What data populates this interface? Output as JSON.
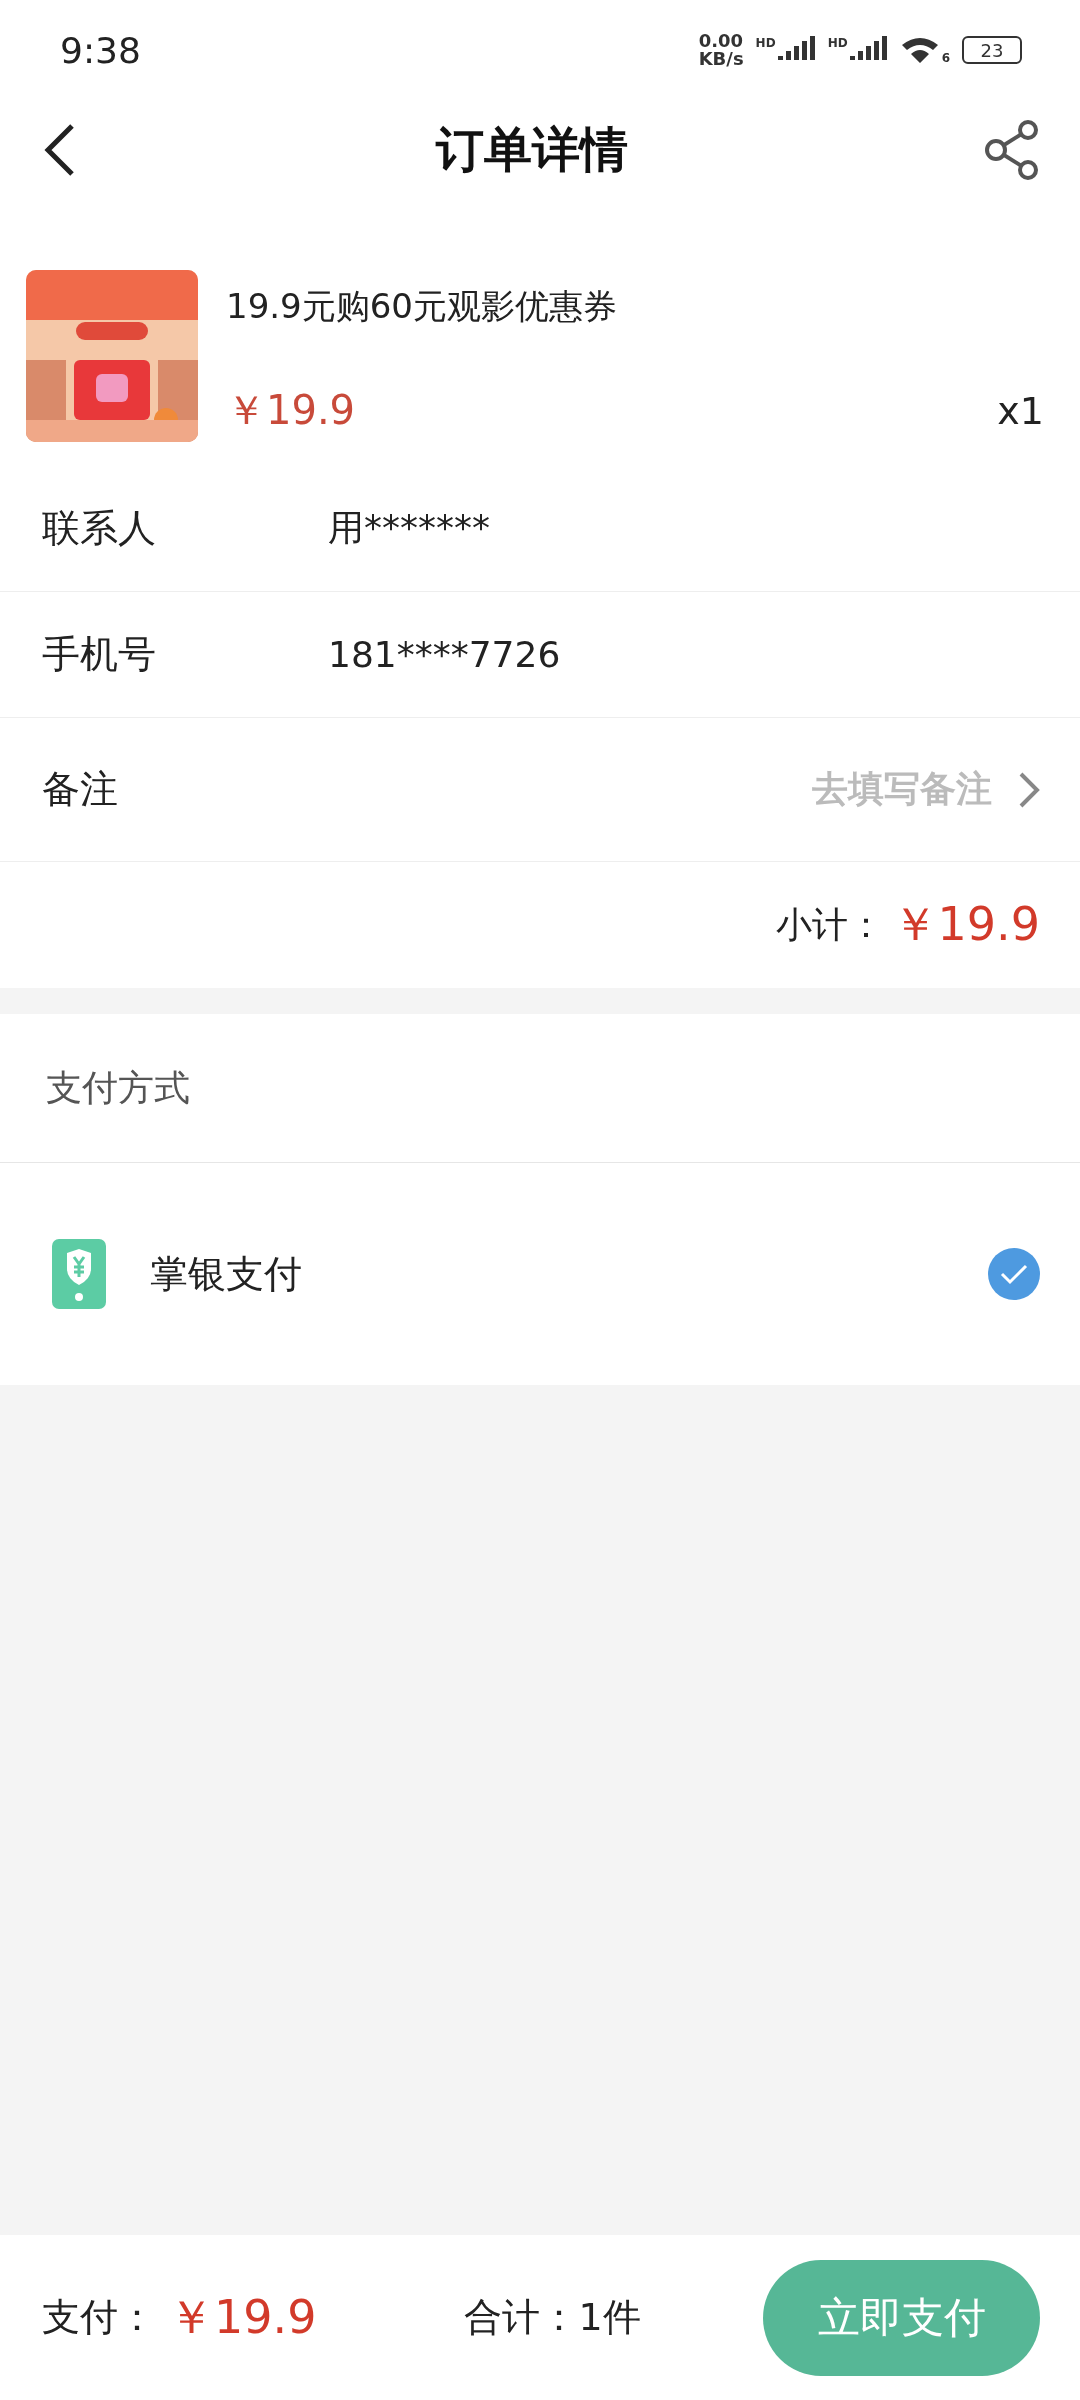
{
  "status_bar": {
    "time": "9:38",
    "net_speed": "0.00",
    "net_unit": "KB/s",
    "sim_labels": [
      "HD",
      "HD"
    ],
    "wifi_label": "6",
    "battery": "23"
  },
  "header": {
    "title": "订单详情"
  },
  "product": {
    "name": "19.9元购60元观影优惠券",
    "price": "￥19.9",
    "quantity": "x1"
  },
  "fields": [
    {
      "label": "联系人",
      "value": "用*******",
      "kind": "text"
    },
    {
      "label": "手机号",
      "value": "181****7726",
      "kind": "text"
    },
    {
      "label": "备注",
      "placeholder": "去填写备注",
      "kind": "link"
    }
  ],
  "subtotal": {
    "label": "小计：",
    "amount": "￥19.9"
  },
  "payment": {
    "title": "支付方式",
    "methods": [
      {
        "name": "掌银支付",
        "selected": true
      }
    ]
  },
  "footer": {
    "pay_label": "支付：",
    "pay_amount": "￥19.9",
    "total": "合计：1件",
    "button": "立即支付"
  }
}
